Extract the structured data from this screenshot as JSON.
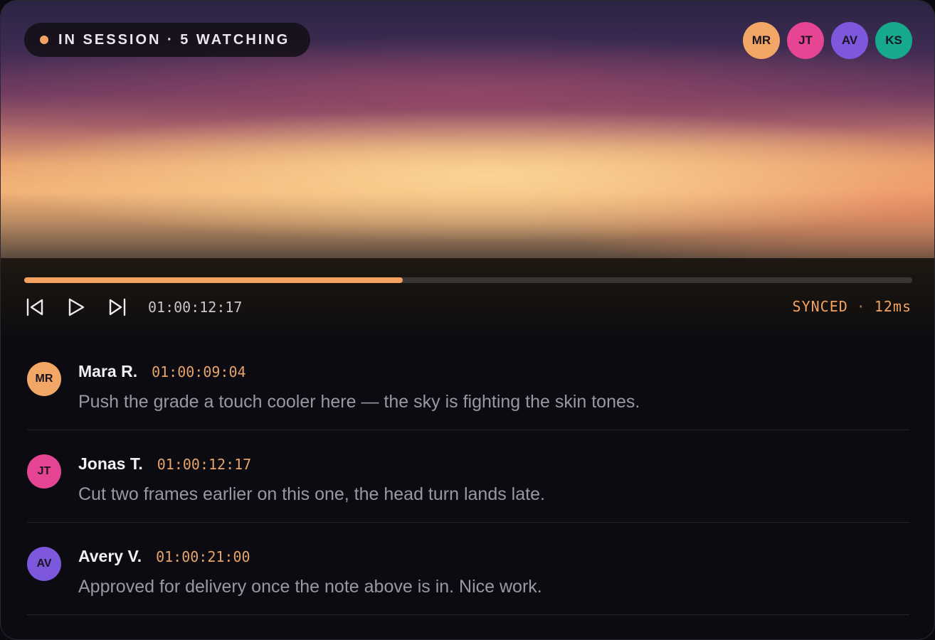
{
  "session": {
    "status": "IN SESSION · 5 WATCHING",
    "status_color": "#f3a35f"
  },
  "viewers": [
    {
      "initials": "MR",
      "color": "#f2a766"
    },
    {
      "initials": "JT",
      "color": "#e54593"
    },
    {
      "initials": "AV",
      "color": "#7d58dd"
    },
    {
      "initials": "KS",
      "color": "#16a98e"
    }
  ],
  "player": {
    "progress": 0.426,
    "timecode": "01:00:12:17",
    "sync_label": "SYNCED",
    "sync_sep": "·",
    "sync_latency": "12ms",
    "accent": "#f3a35f"
  },
  "comments": [
    {
      "initials": "MR",
      "color": "#f2a766",
      "name": "Mara R.",
      "timecode": "01:00:09:04",
      "text": "Push the grade a touch cooler here — the sky is fighting the skin tones."
    },
    {
      "initials": "JT",
      "color": "#e54593",
      "name": "Jonas T.",
      "timecode": "01:00:12:17",
      "text": "Cut two frames earlier on this one, the head turn lands late."
    },
    {
      "initials": "AV",
      "color": "#7d58dd",
      "name": "Avery V.",
      "timecode": "01:00:21:00",
      "text": "Approved for delivery once the note above is in. Nice work."
    }
  ]
}
